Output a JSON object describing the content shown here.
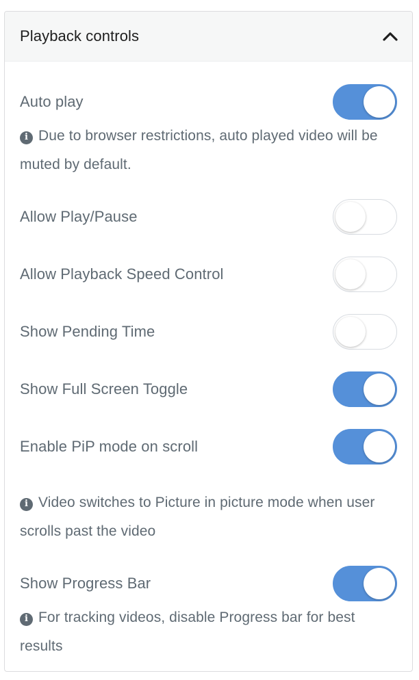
{
  "panel": {
    "title": "Playback controls",
    "collapse_icon": "chevron-up-icon"
  },
  "settings": [
    {
      "label": "Auto play",
      "enabled": true
    },
    {
      "label": "Allow Play/Pause",
      "enabled": false
    },
    {
      "label": "Allow Playback Speed Control",
      "enabled": false
    },
    {
      "label": "Show Pending Time",
      "enabled": false
    },
    {
      "label": "Show Full Screen Toggle",
      "enabled": true
    },
    {
      "label": "Enable PiP mode on scroll",
      "enabled": true
    },
    {
      "label": "Show Progress Bar",
      "enabled": true
    }
  ],
  "help": {
    "autoplay": "Due to browser restrictions, auto played video will be muted by default.",
    "pip": "Video switches to Picture in picture mode when user scrolls past the video",
    "progress": "For tracking videos, disable Progress bar for best results"
  },
  "icons": {
    "info": "info-icon",
    "info_glyph": "i"
  },
  "colors": {
    "toggle_on": "#5590d9",
    "text": "#5f6a73",
    "header_bg": "#f6f7f7"
  }
}
